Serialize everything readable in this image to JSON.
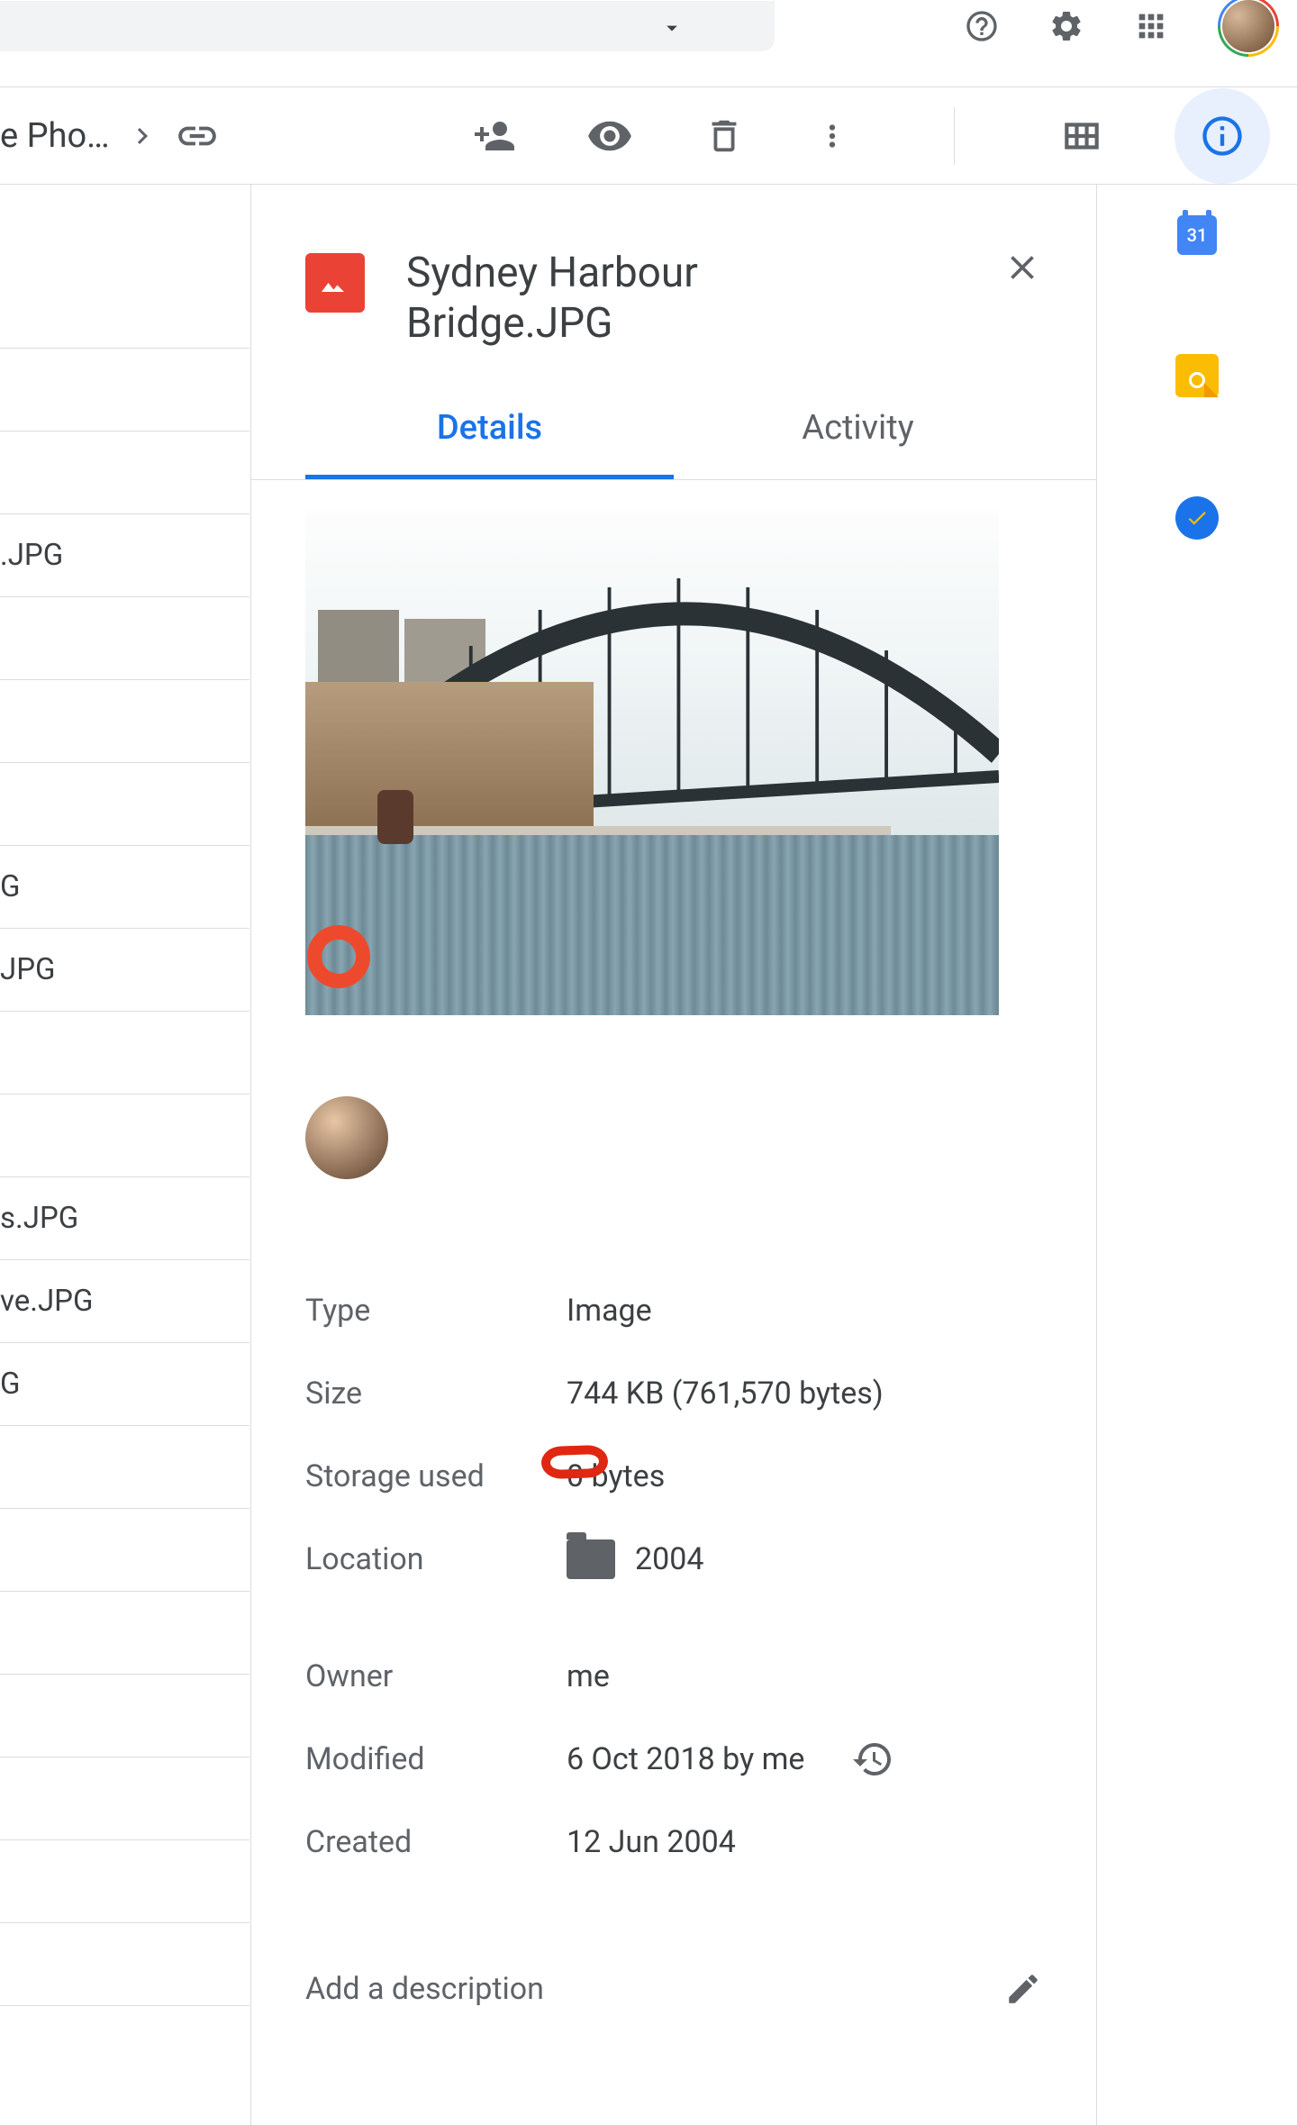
{
  "breadcrumb": {
    "folder_truncated": "e Pho…"
  },
  "tabs": {
    "details": "Details",
    "activity": "Activity"
  },
  "file": {
    "title": "Sydney Harbour Bridge.JPG"
  },
  "meta_labels": {
    "type": "Type",
    "size": "Size",
    "storage": "Storage used",
    "location": "Location",
    "owner": "Owner",
    "modified": "Modified",
    "created": "Created"
  },
  "meta_values": {
    "type": "Image",
    "size": "744 KB (761,570 bytes)",
    "storage": "0 bytes",
    "location": "2004",
    "owner": "me",
    "modified": "6 Oct 2018 by me",
    "created": "12 Jun 2004"
  },
  "description_placeholder": "Add a description",
  "file_list": [
    "",
    "",
    "",
    "",
    ".JPG",
    "",
    "",
    "",
    "G",
    "JPG",
    "",
    "",
    "s.JPG",
    "ve.JPG",
    "G",
    "",
    "",
    "",
    "",
    "",
    ""
  ],
  "calendar_day": "31"
}
